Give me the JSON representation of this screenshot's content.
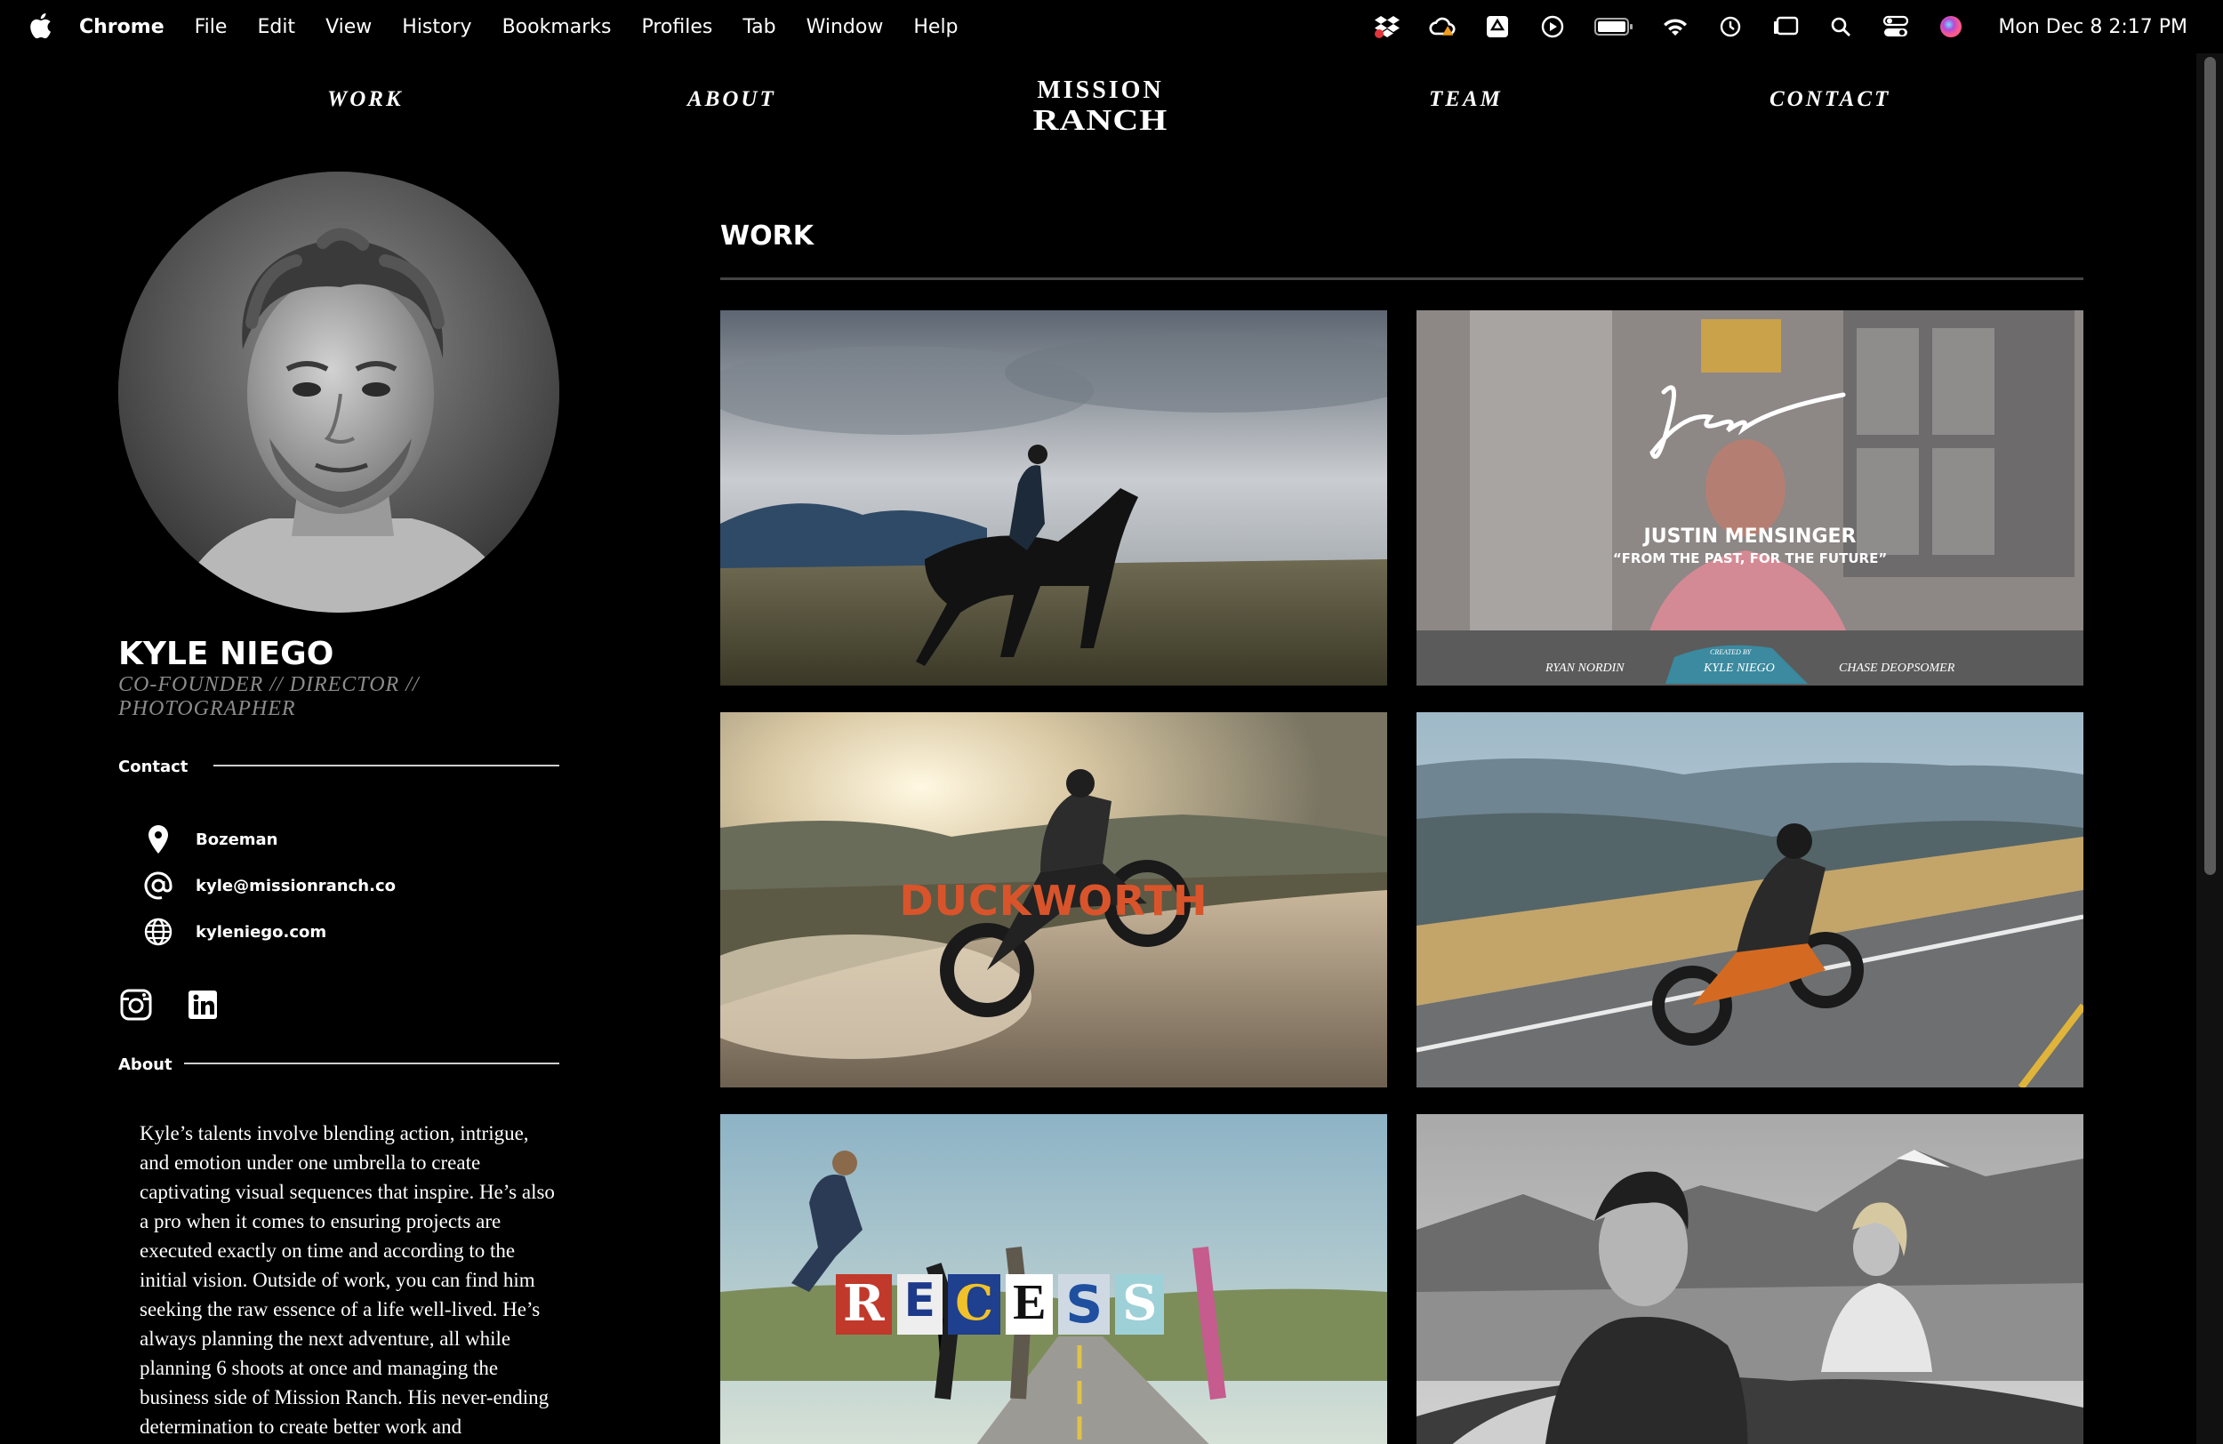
{
  "menubar": {
    "app_name": "Chrome",
    "menus": [
      "File",
      "Edit",
      "View",
      "History",
      "Bookmarks",
      "Profiles",
      "Tab",
      "Window",
      "Help"
    ],
    "clock": "Mon Dec 8  2:17 PM"
  },
  "nav": {
    "work": "WORK",
    "about": "ABOUT",
    "team": "TEAM",
    "contact": "CONTACT",
    "logo_line1": "MISSION",
    "logo_line2": "RANCH"
  },
  "profile": {
    "name": "KYLE NIEGO",
    "role": "CO-FOUNDER // DIRECTOR // PHOTOGRAPHER",
    "contact_heading": "Contact",
    "location": "Bozeman",
    "email": "kyle@missionranch.co",
    "website": "kyleniego.com",
    "about_heading": "About",
    "about_text": "Kyle’s talents involve blending action, intrigue, and emotion under one umbrella to create captivating visual sequences that inspire. He’s also a pro when it comes to ensuring projects are executed exactly on time and according to the initial vision. Outside of work, you can find him seeking the raw essence of a life well-lived. He’s always planning the next adventure, all while planning 6 shoots at once and managing the business side of Mission Ranch. His never-ending determination to create better work and"
  },
  "work": {
    "heading": "WORK",
    "tiles": {
      "justin_title": "JUSTIN MENSINGER",
      "justin_subtitle": "“FROM THE PAST, FOR THE FUTURE”",
      "justin_credit_left": "RYAN NORDIN",
      "justin_credit_mid_label": "CREATED BY",
      "justin_credit_mid": "KYLE NIEGO",
      "justin_credit_right": "CHASE DEOPSOMER",
      "duckworth_title": "DUCKWORTH",
      "recess_letters": [
        "R",
        "E",
        "C",
        "E",
        "S",
        "S"
      ]
    }
  },
  "icons": {
    "location": "map-pin-icon",
    "email": "at-sign-icon",
    "website": "globe-icon",
    "instagram": "instagram-icon",
    "linkedin": "linkedin-icon"
  },
  "colors": {
    "background": "#000000",
    "role_gray": "#8c8c8c",
    "duckworth_orange": "#d9542b"
  }
}
